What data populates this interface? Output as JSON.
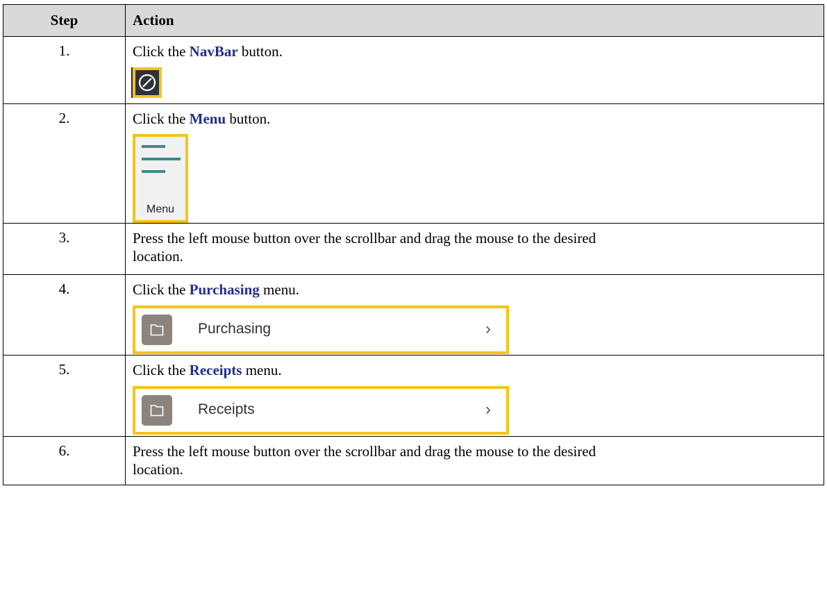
{
  "header": {
    "step": "Step",
    "action": "Action"
  },
  "steps": [
    {
      "num": "1.",
      "pre": "Click the ",
      "kw": "NavBar",
      "post": " button."
    },
    {
      "num": "2.",
      "pre": "Click the ",
      "kw": "Menu",
      "post": " button.",
      "button_label": "Menu"
    },
    {
      "num": "3.",
      "text1": "Press the left mouse button over the scrollbar and drag the mouse to the desired",
      "text2": "location."
    },
    {
      "num": "4.",
      "pre": "Click the ",
      "kw": "Purchasing",
      "post": " menu.",
      "menu_label": "Purchasing"
    },
    {
      "num": "5.",
      "pre": "Click the ",
      "kw": "Receipts",
      "post": " menu.",
      "menu_label": "Receipts"
    },
    {
      "num": "6.",
      "text1": "Press the left mouse button over the scrollbar and drag the mouse to the desired",
      "text2": "location."
    }
  ],
  "colors": {
    "highlight": "#f4c518",
    "keyword": "#1f2e8f",
    "header_bg": "#d9d9d9",
    "menu_icon": "#3d8a8a",
    "folder_tile": "#8a847c"
  },
  "icons": {
    "navbar": "compass-icon",
    "menu": "hamburger-icon",
    "folder": "folder-icon",
    "chevron": "chevron-right-icon"
  }
}
